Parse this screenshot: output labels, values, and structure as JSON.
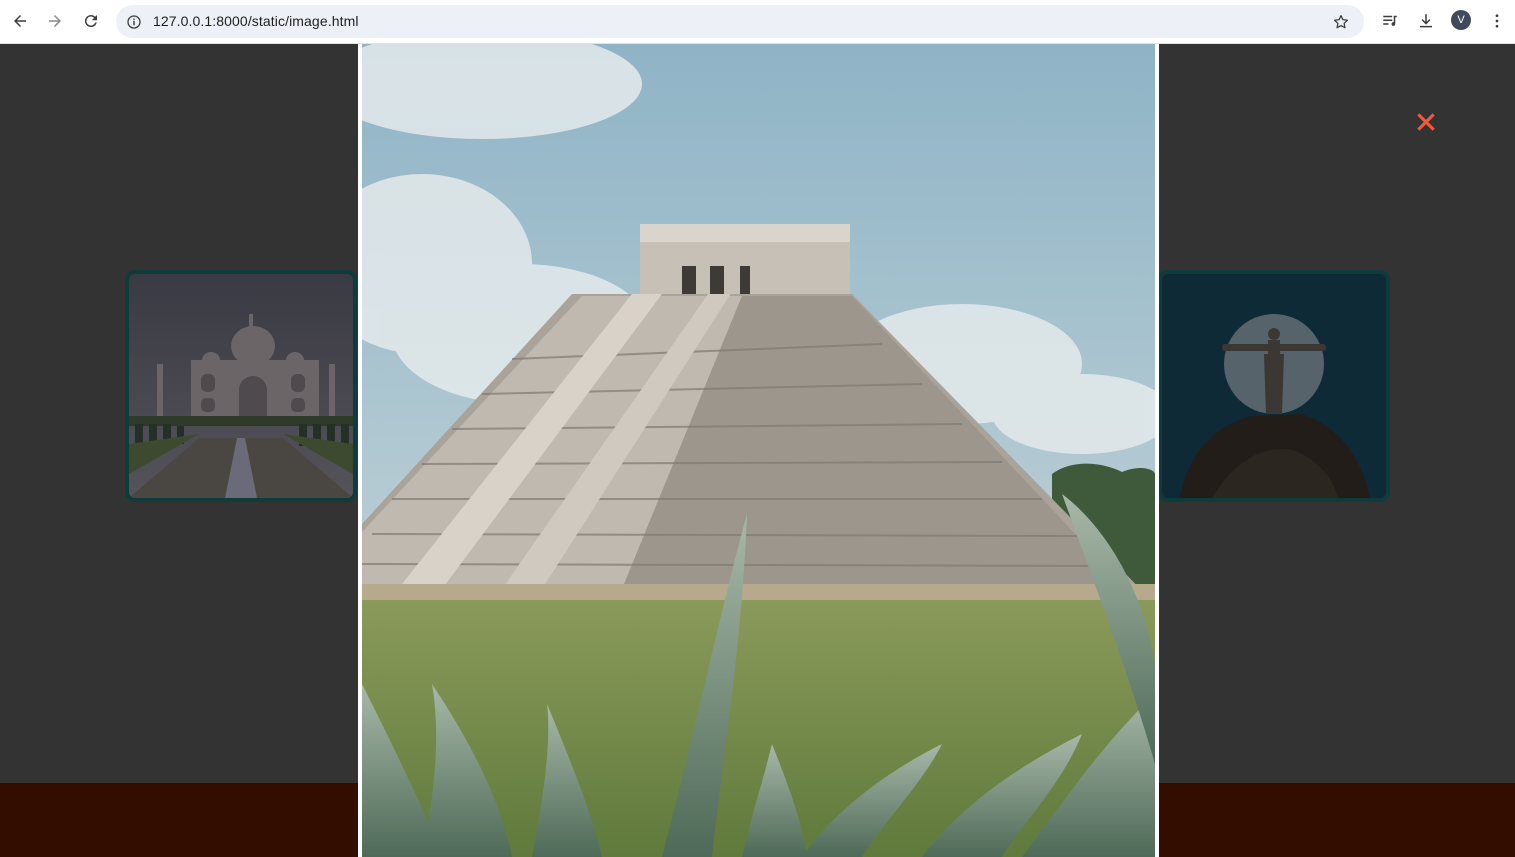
{
  "browser": {
    "url": "127.0.0.1:8000/static/image.html",
    "profile_initial": "V",
    "icons": {
      "back": "arrow-left-icon",
      "forward": "arrow-right-icon",
      "reload": "reload-icon",
      "site_info": "info-icon",
      "bookmark": "star-icon",
      "media": "media-controls-icon",
      "downloads": "download-icon",
      "menu": "kebab-menu-icon"
    }
  },
  "gallery": {
    "background_color": "#333333",
    "footer_color": "#330d00",
    "close_icon": "close-x-icon",
    "close_color": "#f05a3c",
    "thumbnail_border_color": "#0f3b3b",
    "main_image": "pyramid-photo",
    "left_thumbnail": "taj-mahal-photo",
    "right_thumbnail": "christ-redeemer-photo"
  }
}
